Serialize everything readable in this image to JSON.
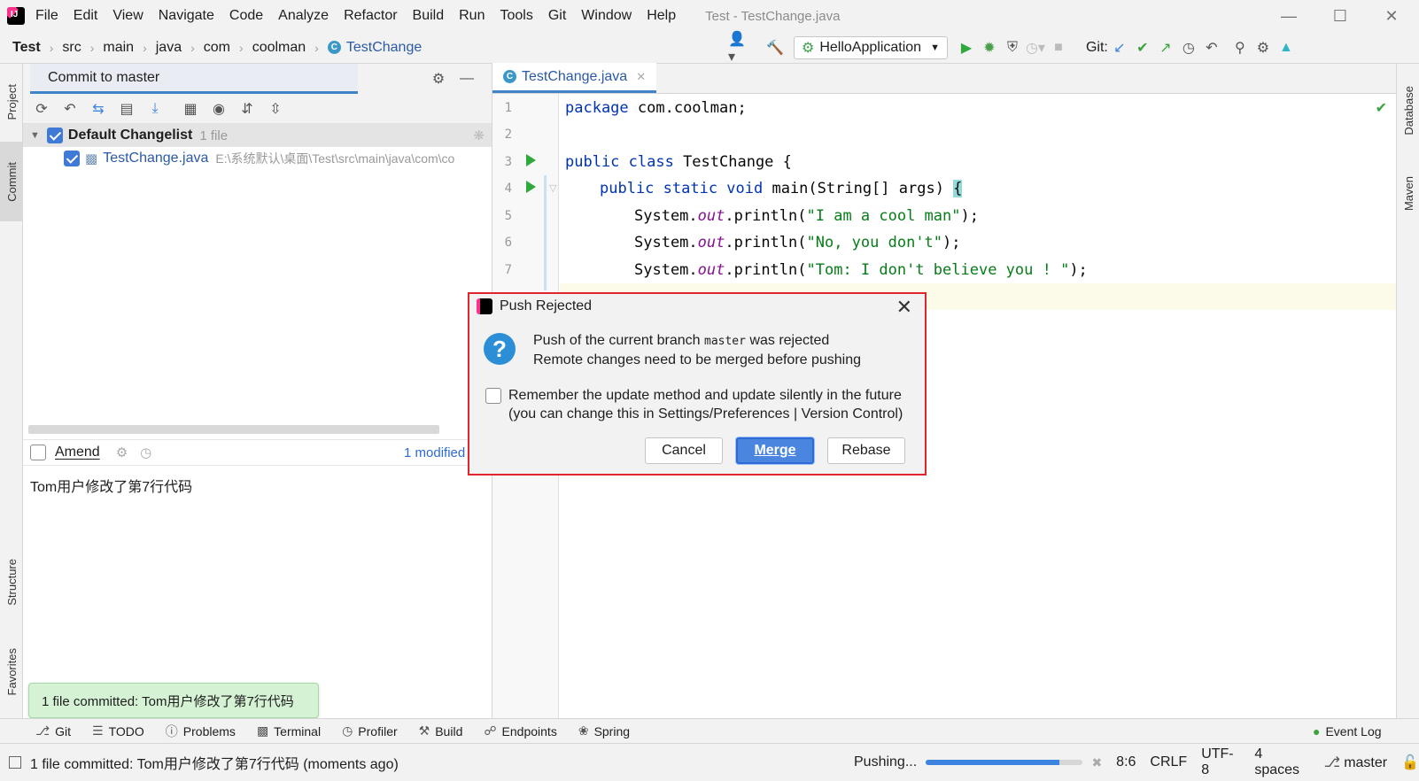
{
  "window": {
    "title": "Test - TestChange.java"
  },
  "menu": [
    {
      "label": "File",
      "mnemonic": "F"
    },
    {
      "label": "Edit",
      "mnemonic": "E"
    },
    {
      "label": "View",
      "mnemonic": "V"
    },
    {
      "label": "Navigate",
      "mnemonic": "N"
    },
    {
      "label": "Code",
      "mnemonic": "C"
    },
    {
      "label": "Analyze",
      "mnemonic": "z"
    },
    {
      "label": "Refactor",
      "mnemonic": "R"
    },
    {
      "label": "Build",
      "mnemonic": "B"
    },
    {
      "label": "Run",
      "mnemonic": "u"
    },
    {
      "label": "Tools",
      "mnemonic": "T"
    },
    {
      "label": "Git",
      "mnemonic": "G"
    },
    {
      "label": "Window",
      "mnemonic": "W"
    },
    {
      "label": "Help",
      "mnemonic": "H"
    }
  ],
  "breadcrumb": [
    "Test",
    "src",
    "main",
    "java",
    "com",
    "coolman",
    "TestChange"
  ],
  "toolbar": {
    "run_config": "HelloApplication",
    "git_label": "Git:"
  },
  "side_tabs": {
    "project": "Project",
    "commit": "Commit",
    "structure": "Structure",
    "favorites": "Favorites",
    "database": "Database",
    "maven": "Maven"
  },
  "commit_panel": {
    "tab": "Commit to master",
    "changelist": {
      "name": "Default Changelist",
      "count": "1 file"
    },
    "file": {
      "name": "TestChange.java",
      "path": "E:\\系统默认\\桌面\\Test\\src\\main\\java\\com\\co"
    },
    "amend_label": "Amend",
    "modified": "1 modified",
    "message": "Tom用户修改了第7行代码"
  },
  "toast": "1 file committed: Tom用户修改了第7行代码",
  "editor": {
    "tab": "TestChange.java",
    "line_numbers": [
      "1",
      "2",
      "3",
      "4",
      "5",
      "6",
      "7"
    ],
    "lines": {
      "l1_kw": "package",
      "l1_rest": " com.coolman;",
      "l3_kw": "public class",
      "l3_rest": " TestChange {",
      "l4_kw": "public static void",
      "l4_rest": " main(String[] args) ",
      "l4_brace": "{",
      "l5_a": "System.",
      "l5_fld": "out",
      "l5_b": ".println(",
      "l5_str": "\"I am a cool man\"",
      "l5_c": ");",
      "l6_a": "System.",
      "l6_fld": "out",
      "l6_b": ".println(",
      "l6_str": "\"No, you don't\"",
      "l6_c": ");",
      "l7_a": "System.",
      "l7_fld": "out",
      "l7_b": ".println(",
      "l7_str": "\"Tom: I don't believe you ! \"",
      "l7_c": ");"
    }
  },
  "dialog": {
    "title": "Push Rejected",
    "msg_prefix": "Push of the current branch ",
    "branch": "master",
    "msg_suffix": " was rejected",
    "msg_line2": "Remote changes need to be merged before pushing",
    "remember_line1": "Remember the update method and update silently in the future",
    "remember_line2": "(you can change this in Settings/Preferences | Version Control)",
    "cancel": "Cancel",
    "merge": "Merge",
    "rebase": "Rebase"
  },
  "tool_tabs": [
    "Git",
    "TODO",
    "Problems",
    "Terminal",
    "Profiler",
    "Build",
    "Endpoints",
    "Spring",
    "Event Log"
  ],
  "status": {
    "message": "1 file committed: Tom用户修改了第7行代码 (moments ago)",
    "task": "Pushing...",
    "progress": 0.85,
    "position": "8:6",
    "line_sep": "CRLF",
    "encoding": "UTF-8",
    "indent": "4 spaces",
    "branch": "master"
  },
  "colors": {
    "accent": "#4083c9",
    "dialog_border": "#e0252c",
    "run_green": "#2eaa3c"
  }
}
